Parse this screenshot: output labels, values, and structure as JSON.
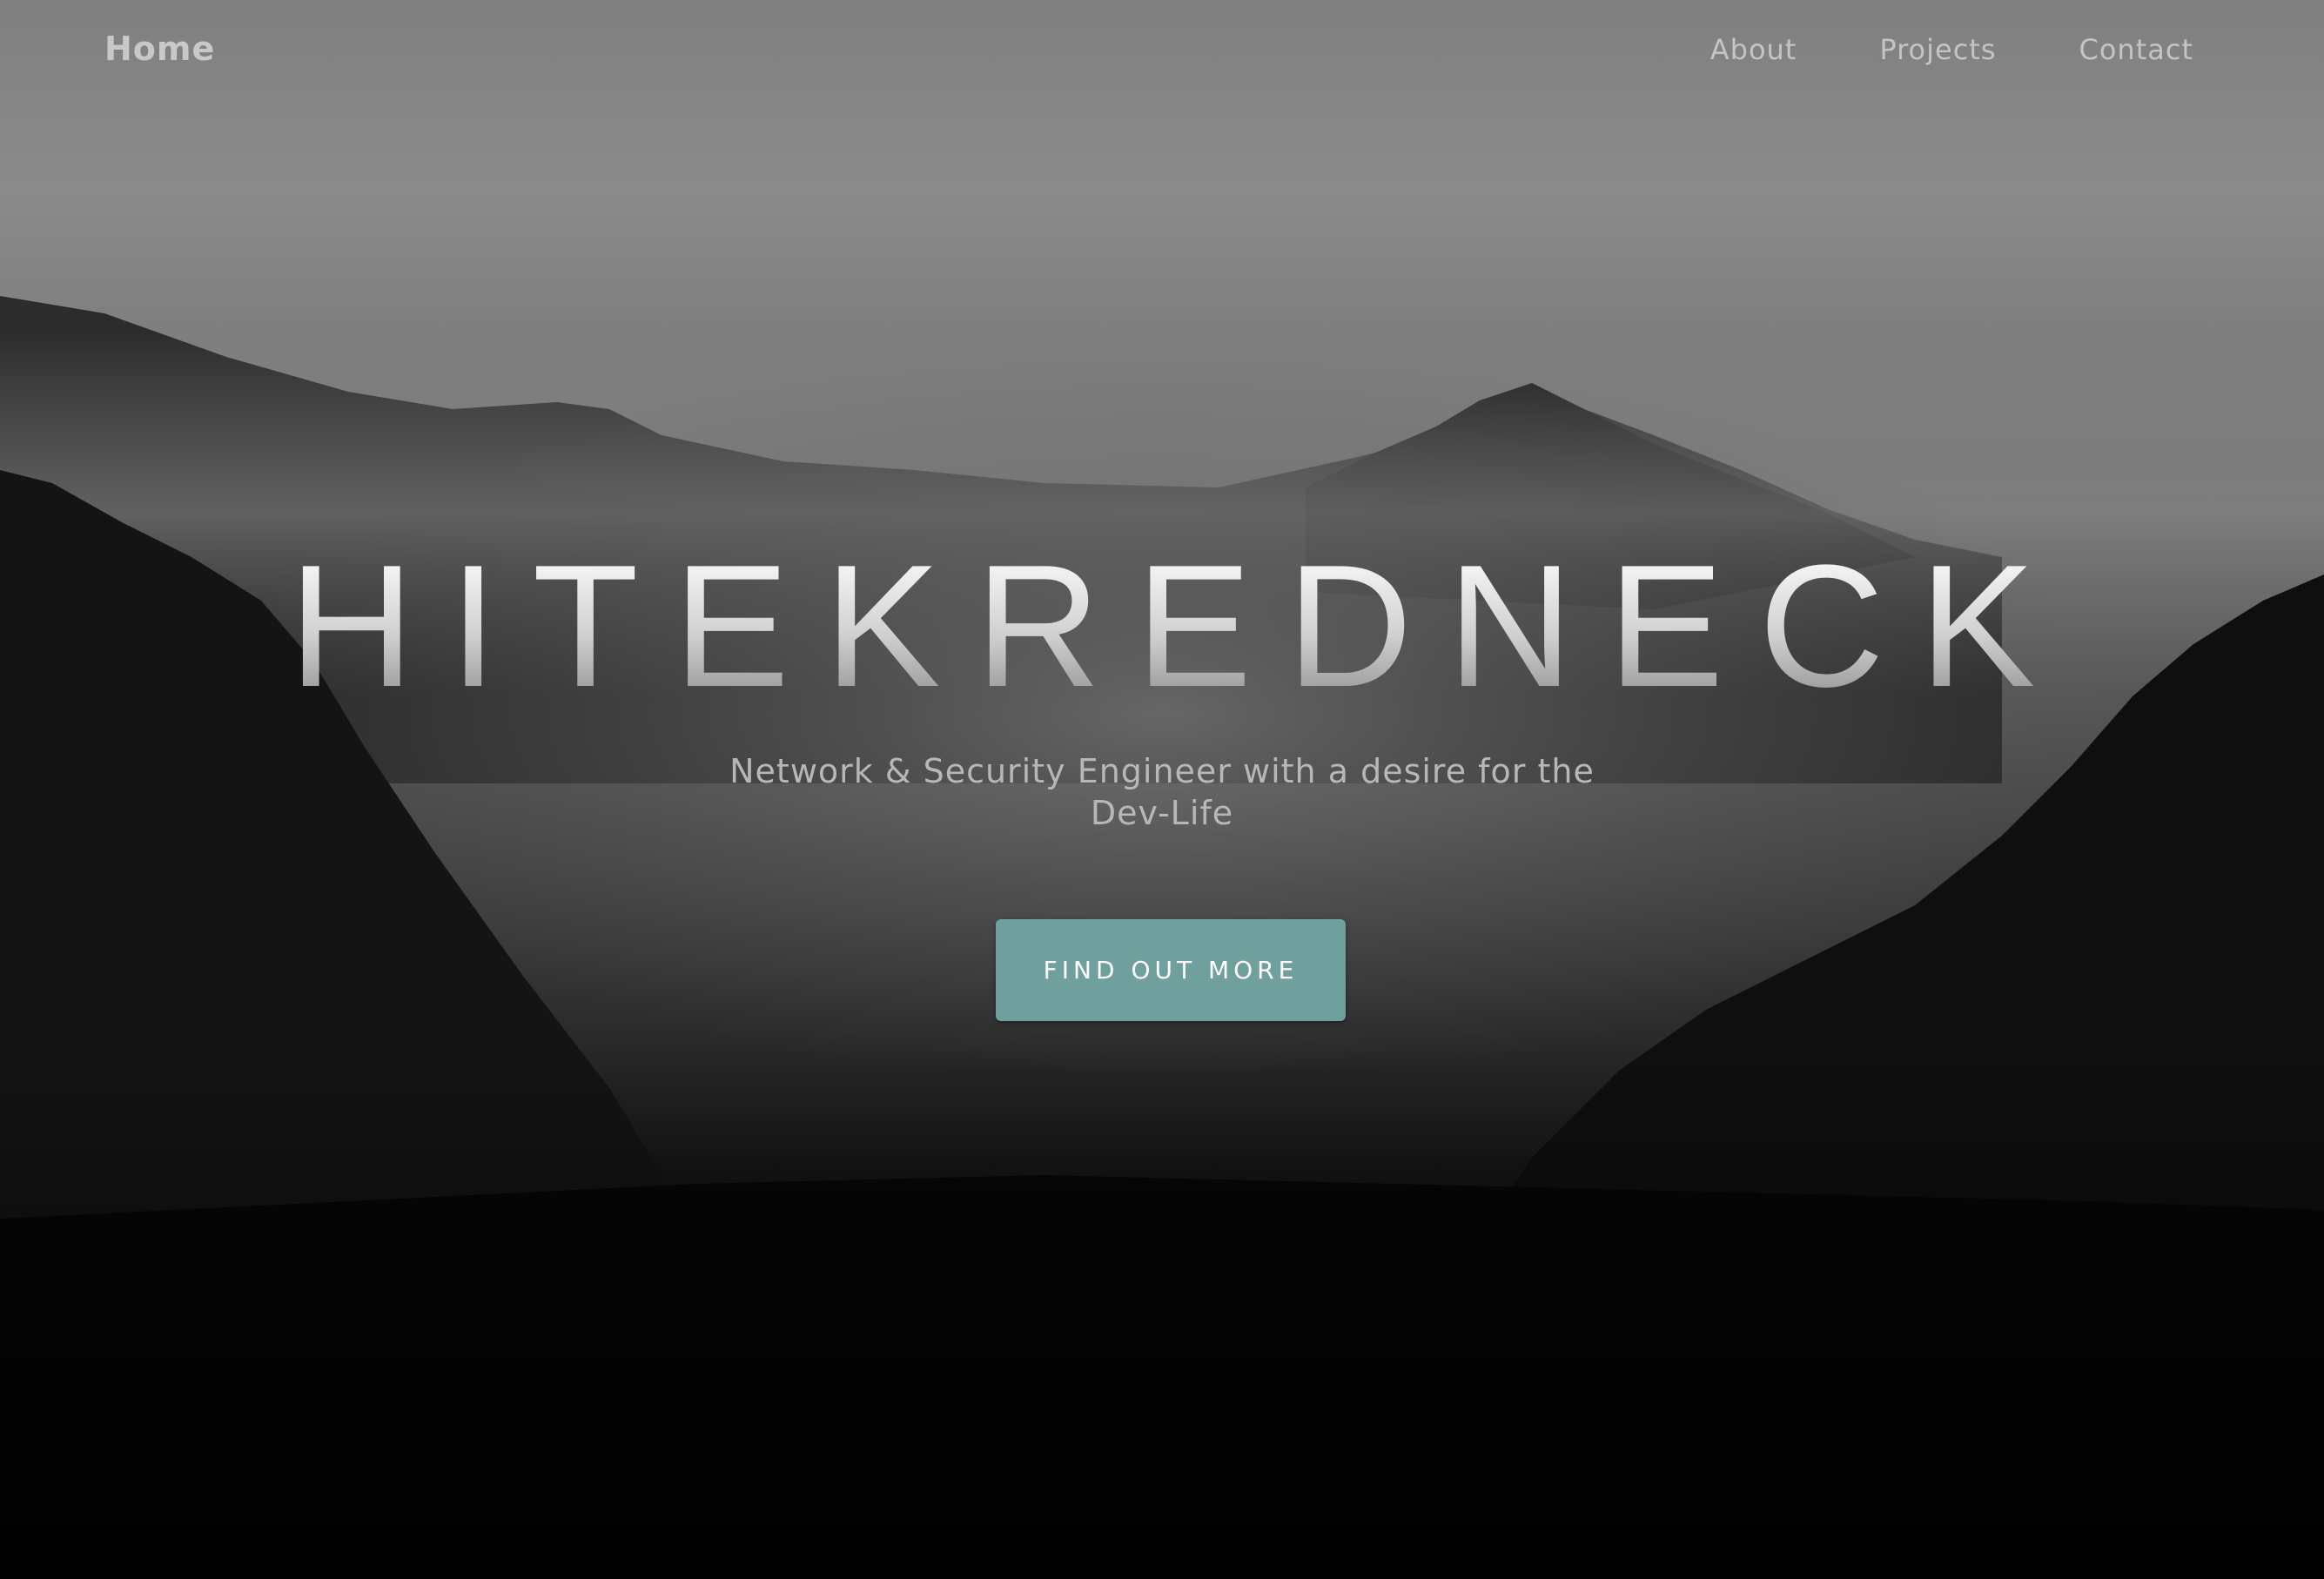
{
  "nav": {
    "brand": "Home",
    "links": [
      "About",
      "Projects",
      "Contact"
    ]
  },
  "hero": {
    "title": "HITEKREDNECK",
    "subtitle": "Network & Security Engineer with a desire for the Dev-Life",
    "cta_label": "FIND OUT MORE"
  },
  "colors": {
    "accent": "#6fa09d"
  },
  "background": {
    "description_icon": "foggy-mountain-forest-image"
  }
}
